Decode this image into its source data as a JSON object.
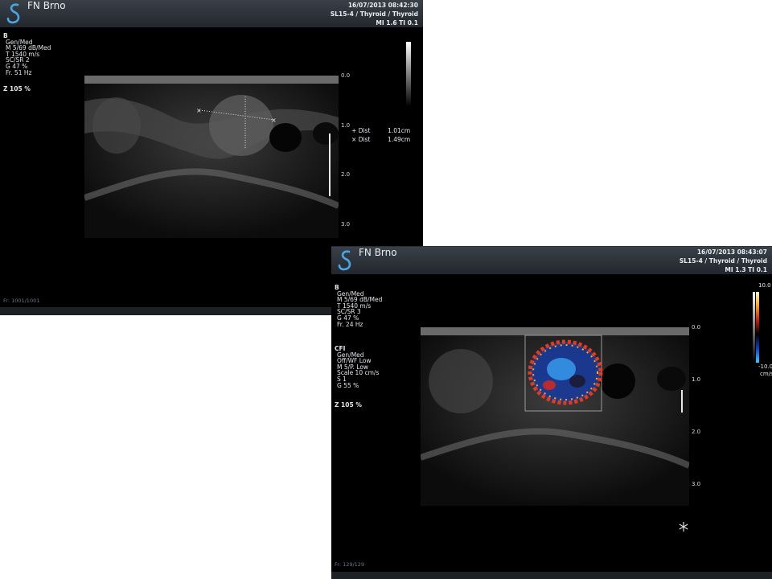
{
  "panel1": {
    "site": "FN Brno",
    "datetime": "16/07/2013 08:42:30",
    "probe": "SL15-4 / Thyroid / Thyroid",
    "mi_ti": "MI 1.6  TI 0.1",
    "params": {
      "mode": "B",
      "lines": [
        "Gen/Med",
        "M 5/69 dB/Med",
        "T 1540 m/s",
        "SC/SR 2",
        "G 47 %",
        "Fr. 51 Hz"
      ]
    },
    "zoom": "Z  105  %",
    "depth_labels": [
      "0.0",
      "1.0",
      "2.0",
      "3.0"
    ],
    "measurements": [
      {
        "symbol": "+",
        "label": "Dist",
        "value": "1.01cm"
      },
      {
        "symbol": "×",
        "label": "Dist",
        "value": "1.49cm"
      }
    ],
    "frames": "Fr: 1001/1001"
  },
  "panel2": {
    "site": "FN Brno",
    "datetime": "16/07/2013 08:43:07",
    "probe": "SL15-4 / Thyroid / Thyroid",
    "mi_ti": "MI 1.3  TI 0.1",
    "params": {
      "mode": "B",
      "lines": [
        "Gen/Med",
        "M 5/69 dB/Med",
        "T 1540 m/s",
        "SC/SR 3",
        "G 47 %",
        "Fr. 24 Hz"
      ]
    },
    "cfi": {
      "mode": "CFI",
      "lines": [
        "Gen/Med",
        "Off/WF Low",
        "M 5/P. Low",
        "Scale 10 cm/s",
        "S 1",
        "G 55 %"
      ]
    },
    "zoom": "Z  105  %",
    "depth_labels": [
      "0.0",
      "1.0",
      "2.0",
      "3.0"
    ],
    "color_scale": {
      "top": "10.0",
      "bottom": "-10.0",
      "unit": "cm/s"
    },
    "freeze_icon": "snowflake-icon",
    "frames": "Fr: 129/129"
  },
  "colors": {
    "page": "#ffffff",
    "screen": "#000000",
    "header": "#2e343b",
    "text": "#e6eaee"
  }
}
